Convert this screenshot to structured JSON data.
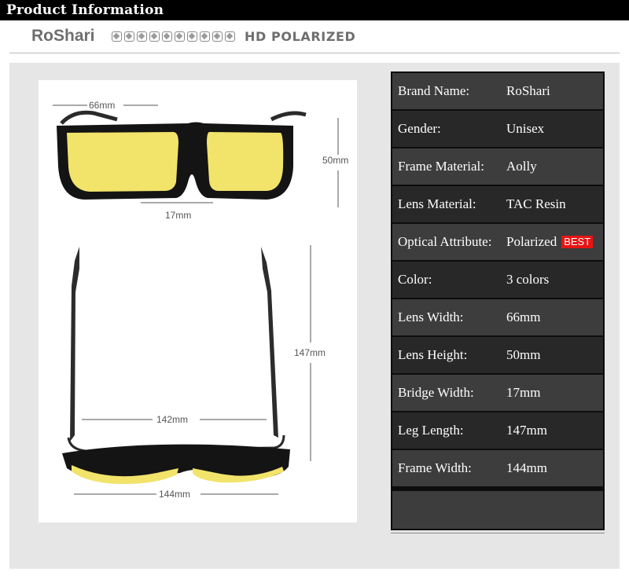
{
  "header": {
    "title": "Product  Information"
  },
  "brand": {
    "name": "RoShari",
    "tagline": "HD POLARIZED",
    "feature_icons": [
      "uv-icon",
      "sport-icon",
      "bike-icon",
      "run-icon",
      "climb-icon",
      "ski-icon",
      "drive-icon",
      "fish-icon",
      "golf-icon",
      "plane-icon"
    ]
  },
  "photo": {
    "dimensions": {
      "lens_width": "66mm",
      "lens_height": "50mm",
      "bridge": "17mm",
      "temple": "147mm",
      "inner_width": "142mm",
      "frame_width": "144mm"
    },
    "colors": {
      "frame": "#141414",
      "lens": "#f2e36a"
    }
  },
  "specs": [
    {
      "label": "Brand Name:",
      "value": "RoShari"
    },
    {
      "label": "Gender:",
      "value": "Unisex"
    },
    {
      "label": "Frame Material:",
      "value": "Aolly"
    },
    {
      "label": "Lens Material:",
      "value": "TAC Resin"
    },
    {
      "label": "Optical Attribute:",
      "value": "Polarized",
      "badge": "BEST"
    },
    {
      "label": "Color:",
      "value": "3 colors"
    },
    {
      "label": "Lens Width:",
      "value": "66mm"
    },
    {
      "label": "Lens Height:",
      "value": "50mm"
    },
    {
      "label": "Bridge Width:",
      "value": "17mm"
    },
    {
      "label": "Leg Length:",
      "value": "147mm"
    },
    {
      "label": "Frame Width:",
      "value": "144mm"
    }
  ],
  "theme": {
    "row_light": "#3d3d3d",
    "row_dark": "#282828",
    "badge": "#e81414"
  }
}
